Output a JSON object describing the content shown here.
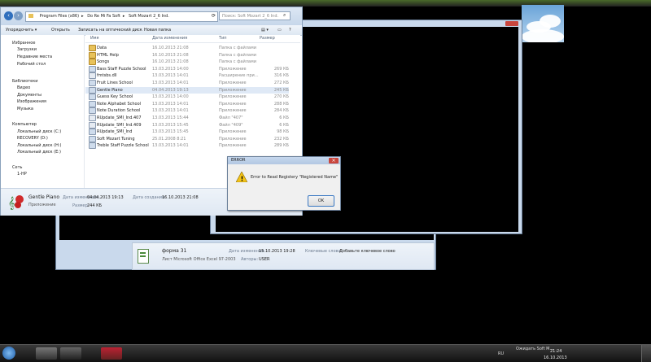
{
  "explorer": {
    "breadcrumbs": [
      "Program Files (x86)",
      "Do Re Mi Fa Soft",
      "Soft Mozart 2_6 Ind."
    ],
    "search_placeholder": "Поиск: Soft Mozart 2_6 Ind.",
    "toolbar": {
      "organize": "Упорядочить ▾",
      "open": "Открыть",
      "burn": "Записать на оптический диск",
      "new_folder": "Новая папка"
    },
    "nav": {
      "favorites": "Избранное",
      "downloads": "Загрузки",
      "recent": "Недавние места",
      "desktop": "Рабочий стол",
      "libraries": "Библиотеки",
      "video": "Видео",
      "documents": "Документы",
      "pictures": "Изображения",
      "music": "Музыка",
      "computer": "Компьютер",
      "drive_c": "Локальный диск (C:)",
      "drive_d": "RECOVERY (D:)",
      "drive_h": "Локальный диск (H:)",
      "drive_e": "Локальный диск (E:)",
      "network": "Сеть",
      "network_pc": "1-HP"
    },
    "columns": {
      "name": "Имя",
      "date": "Дата изменения",
      "type": "Тип",
      "size": "Размер"
    },
    "files": [
      {
        "name": "Data",
        "date": "16.10.2013 21:08",
        "type": "Папка с файлами",
        "size": ""
      },
      {
        "name": "HTML Help",
        "date": "16.10.2013 21:08",
        "type": "Папка с файлами",
        "size": ""
      },
      {
        "name": "Songs",
        "date": "16.10.2013 21:08",
        "type": "Папка с файлами",
        "size": ""
      },
      {
        "name": "Bass Staff Puzzle School",
        "date": "13.03.2013 14:00",
        "type": "Приложение",
        "size": "269 КБ"
      },
      {
        "name": "fmtsbs.dll",
        "date": "13.03.2013 14:01",
        "type": "Расширение при...",
        "size": "316 КБ"
      },
      {
        "name": "Fruit Lines School",
        "date": "13.03.2013 14:01",
        "type": "Приложение",
        "size": "272 КБ"
      },
      {
        "name": "Gentle Piano",
        "date": "04.04.2013 19:13",
        "type": "Приложение",
        "size": "245 КБ"
      },
      {
        "name": "Guess Key School",
        "date": "13.03.2013 14:00",
        "type": "Приложение",
        "size": "270 КБ"
      },
      {
        "name": "Note Alphabet School",
        "date": "13.03.2013 14:01",
        "type": "Приложение",
        "size": "288 КБ"
      },
      {
        "name": "Note Duration School",
        "date": "13.03.2013 14:01",
        "type": "Приложение",
        "size": "284 КБ"
      },
      {
        "name": "RUpdate_SMI_Ind.407",
        "date": "13.03.2013 15:44",
        "type": "Файл \"407\"",
        "size": "6 КБ"
      },
      {
        "name": "RUpdate_SMI_Ind.409",
        "date": "13.03.2013 15:45",
        "type": "Файл \"409\"",
        "size": "6 КБ"
      },
      {
        "name": "RUpdate_SMI_Ind",
        "date": "13.03.2013 15:45",
        "type": "Приложение",
        "size": "98 КБ"
      },
      {
        "name": "Soft Mozart Tuning",
        "date": "25.01.2008 8:21",
        "type": "Приложение",
        "size": "232 КБ"
      },
      {
        "name": "Treble Staff Puzzle School",
        "date": "13.03.2013 14:01",
        "type": "Приложение",
        "size": "289 КБ"
      }
    ],
    "details": {
      "name": "Gentle Piano",
      "kind": "Приложение",
      "modified_label": "Дата изменения:",
      "modified": "04.04.2013 19:13",
      "created_label": "Дата создания:",
      "created": "16.10.2013 21:08",
      "size_label": "Размер:",
      "size": "244 КБ"
    }
  },
  "dialog": {
    "title": "ERROR",
    "message": "Error to Read Registery \"Registered Name\"",
    "ok": "OK"
  },
  "file2": {
    "name": "форма 31",
    "kind": "Лист Microsoft Office Excel 97-2003",
    "modified_label": "Дата изменения:",
    "modified": "15.10.2013 19:28",
    "keywords_label": "Ключевые слова:",
    "keywords": "Добавьте ключевое слово",
    "authors_label": "Авторы:",
    "authors": "USER"
  },
  "taskbar": {
    "notif": "Ожидать Soft M...",
    "lang": "RU",
    "time": "21:24",
    "date": "16.10.2013"
  }
}
